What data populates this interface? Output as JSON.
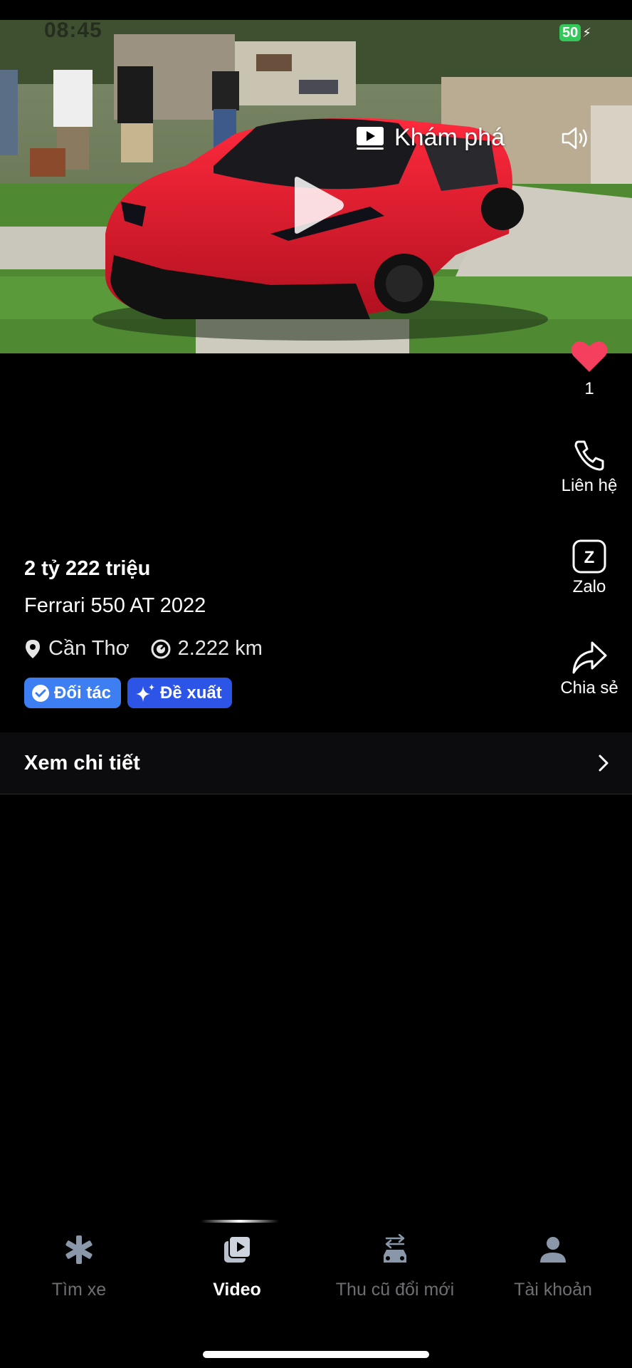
{
  "status_bar": {
    "time": "08:45",
    "battery": "50"
  },
  "video": {
    "explore_label": "Khám phá",
    "icons": [
      "play-icon",
      "speaker-icon",
      "explore-video-icon"
    ]
  },
  "actions": {
    "like_count": "1",
    "contact_label": "Liên hệ",
    "zalo_label": "Zalo",
    "share_label": "Chia sẻ",
    "colors": {
      "heart": "#f43f5e"
    }
  },
  "listing": {
    "price": "2 tỷ 222 triệu",
    "name": "Ferrari 550 AT 2022",
    "location": "Cần Thơ",
    "mileage": "2.222 km",
    "badges": [
      {
        "label": "Đối tác",
        "color": "#3d7ff2",
        "icon": "verified-icon"
      },
      {
        "label": "Đề xuất",
        "color": "#2c54e6",
        "icon": "sparkle-icon"
      }
    ],
    "detail_label": "Xem chi tiết"
  },
  "bottom_nav": {
    "items": [
      {
        "label": "Tìm xe",
        "icon": "search-car-icon",
        "active": false
      },
      {
        "label": "Video",
        "icon": "video-icon",
        "active": true
      },
      {
        "label": "Thu cũ đổi mới",
        "icon": "trade-in-icon",
        "active": false
      },
      {
        "label": "Tài khoản",
        "icon": "account-icon",
        "active": false
      }
    ]
  }
}
